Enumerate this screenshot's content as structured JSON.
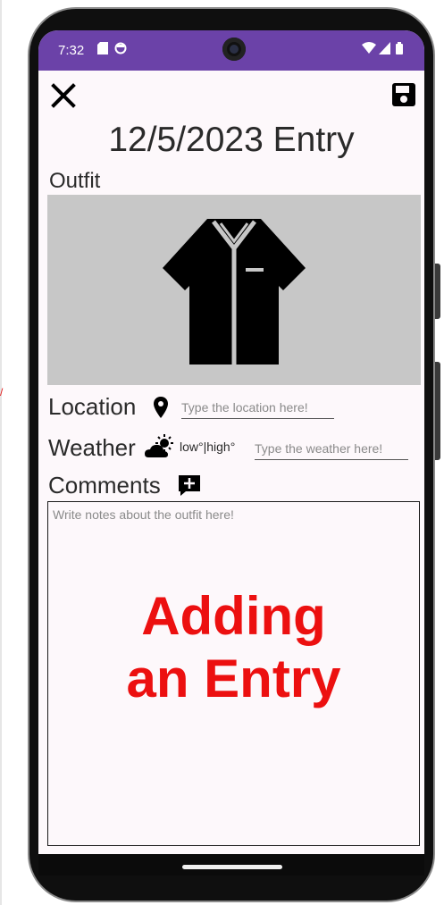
{
  "status_bar": {
    "time": "7:32"
  },
  "header": {
    "title": "12/5/2023 Entry"
  },
  "outfit": {
    "label": "Outfit",
    "image_icon": "shirt-icon"
  },
  "location": {
    "label": "Location",
    "placeholder": "Type the location here!"
  },
  "weather": {
    "label": "Weather",
    "temp_text": "low°|high°",
    "placeholder": "Type the weather here!"
  },
  "comments": {
    "label": "Comments",
    "placeholder": "Write notes about the outfit here!"
  },
  "overlay": {
    "line1": "Adding",
    "line2": "an Entry"
  },
  "colors": {
    "status_bar": "#6b42a8",
    "overlay_text": "#ec1010",
    "image_bg": "#c7c7c7"
  }
}
